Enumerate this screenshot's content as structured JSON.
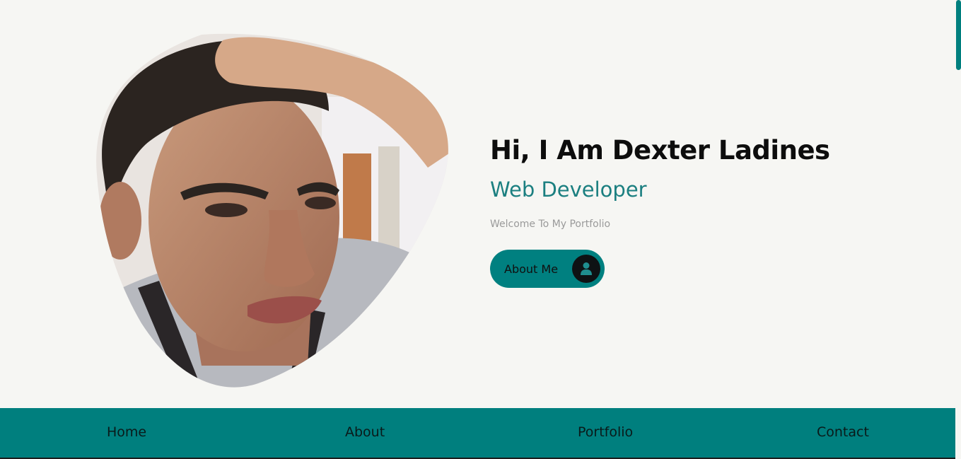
{
  "hero": {
    "title": "Hi, I Am Dexter Ladines",
    "role": "Web Developer",
    "welcome": "Welcome To My Portfolio",
    "button_label": "About Me",
    "button_icon": "user-icon"
  },
  "nav": {
    "items": [
      {
        "label": "Home"
      },
      {
        "label": "About"
      },
      {
        "label": "Portfolio"
      },
      {
        "label": "Contact"
      }
    ]
  },
  "colors": {
    "background": "#f6f6f3",
    "accent": "#008080",
    "role_text": "#1b7f80",
    "title_text": "#0d0d0d",
    "muted_text": "#9a9a9a"
  }
}
